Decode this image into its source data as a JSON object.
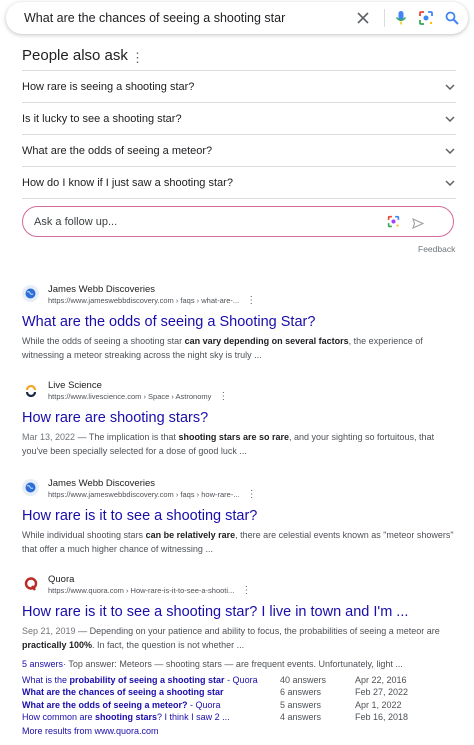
{
  "search": {
    "query": "What are the chances of seeing a shooting star"
  },
  "paa": {
    "title": "People also ask",
    "questions": [
      "How rare is seeing a shooting star?",
      "Is it lucky to see a shooting star?",
      "What are the odds of seeing a meteor?",
      "How do I know if I just saw a shooting star?"
    ]
  },
  "followup": {
    "placeholder": "Ask a follow up...",
    "feedback": "Feedback"
  },
  "results": [
    {
      "source": "James Webb Discoveries",
      "url": "https://www.jameswebbdiscovery.com › faqs › what-are-...",
      "title": "What are the odds of seeing a Shooting Star?",
      "snippet_pre": "While the odds of seeing a shooting star ",
      "snippet_bold": "can vary depending on several factors",
      "snippet_post": ", the experience of witnessing a meteor streaking across the night sky is truly ..."
    },
    {
      "source": "Live Science",
      "url": "https://www.livescience.com › Space › Astronomy",
      "title": "How rare are shooting stars?",
      "date": "Mar 13, 2022",
      "snippet_pre": " — The implication is that ",
      "snippet_bold": "shooting stars are so rare",
      "snippet_post": ", and your sighting so fortuitous, that you've been specially selected for a dose of good luck ..."
    },
    {
      "source": "James Webb Discoveries",
      "url": "https://www.jameswebbdiscovery.com › faqs › how-rare-...",
      "title": "How rare is it to see a shooting star?",
      "snippet_pre": "While individual shooting stars ",
      "snippet_bold": "can be relatively rare",
      "snippet_post": ", there are celestial events known as \"meteor showers\" that offer a much higher chance of witnessing ..."
    },
    {
      "source": "Quora",
      "url": "https://www.quora.com › How-rare-is-it-to-see-a-shooti...",
      "title": "How rare is it to see a shooting star? I live in town and I'm ...",
      "date": "Sep 21, 2019",
      "snippet_pre": " — Depending on your patience and ability to focus, the probabilities of seeing a meteor are ",
      "snippet_bold": "practically 100%",
      "snippet_post": ". In fact, the question is not whether ..."
    }
  ],
  "quora": {
    "answers_link": "5 answers",
    "top_answer": " · Top answer: Meteors — shooting stars — are frequent events. Unfortunately, light ...",
    "rows": [
      {
        "q_pre": "What is the ",
        "q_bold": "probability of seeing a shooting star",
        "q_post": " - Quora",
        "answers": "40 answers",
        "date": "Apr 22, 2016"
      },
      {
        "q_pre": "",
        "q_bold": "What are the chances of seeing a shooting star",
        "q_post": "",
        "answers": "6 answers",
        "date": "Feb 27, 2022"
      },
      {
        "q_pre": "",
        "q_bold": "What are the odds of seeing a meteor?",
        "q_post": " - Quora",
        "answers": "5 answers",
        "date": "Apr 1, 2022"
      },
      {
        "q_pre": "How common are ",
        "q_bold": "shooting stars",
        "q_post": "? I think I saw 2 ...",
        "answers": "4 answers",
        "date": "Feb 16, 2018"
      }
    ],
    "more": "More results from www.quora.com"
  },
  "colors": {
    "link": "#1a0dab",
    "followup_border": "#d36a9b",
    "mic": "#4285f4"
  },
  "icons": [
    "close-icon",
    "mic-icon",
    "lens-icon",
    "search-icon",
    "chevron-down-icon",
    "send-icon",
    "globe-icon",
    "live-science-icon",
    "quora-icon"
  ]
}
